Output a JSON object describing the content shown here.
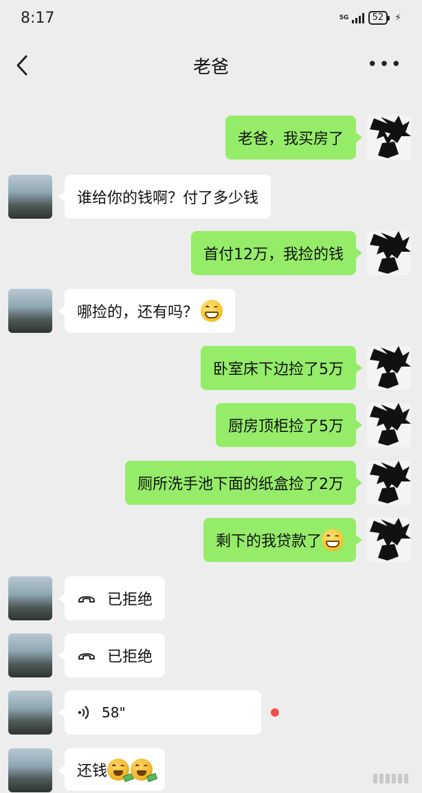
{
  "status_bar": {
    "time": "8:17",
    "network": "5G",
    "battery": "52"
  },
  "header": {
    "title": "老爸",
    "more": "•••"
  },
  "colors": {
    "my_bubble": "#95ec69",
    "their_bubble": "#ffffff",
    "background": "#ededed",
    "unread_dot": "#f04d4d"
  },
  "messages": [
    {
      "sender": "me",
      "text": "老爸，我买房了"
    },
    {
      "sender": "dad",
      "text": "谁给你的钱啊？付了多少钱"
    },
    {
      "sender": "me",
      "text": "首付12万，我捡的钱"
    },
    {
      "sender": "dad",
      "text": "哪捡的，还有吗？",
      "emoji": "grin-emoji"
    },
    {
      "sender": "me",
      "text": "卧室床下边捡了5万"
    },
    {
      "sender": "me",
      "text": "厨房顶柜捡了5万"
    },
    {
      "sender": "me",
      "text": "厕所洗手池下面的纸盒捡了2万"
    },
    {
      "sender": "me",
      "text": "剩下的我贷款了",
      "emoji": "grin-emoji"
    },
    {
      "sender": "dad",
      "type": "call",
      "text": "已拒绝",
      "icon": "phone-hangup-icon"
    },
    {
      "sender": "dad",
      "type": "call",
      "text": "已拒绝",
      "icon": "phone-hangup-icon"
    },
    {
      "sender": "dad",
      "type": "voice",
      "text": "58\"",
      "icon": "voice-icon",
      "unread": true
    },
    {
      "sender": "dad",
      "text": "还钱",
      "emoji": "money-mouth-emoji"
    }
  ]
}
